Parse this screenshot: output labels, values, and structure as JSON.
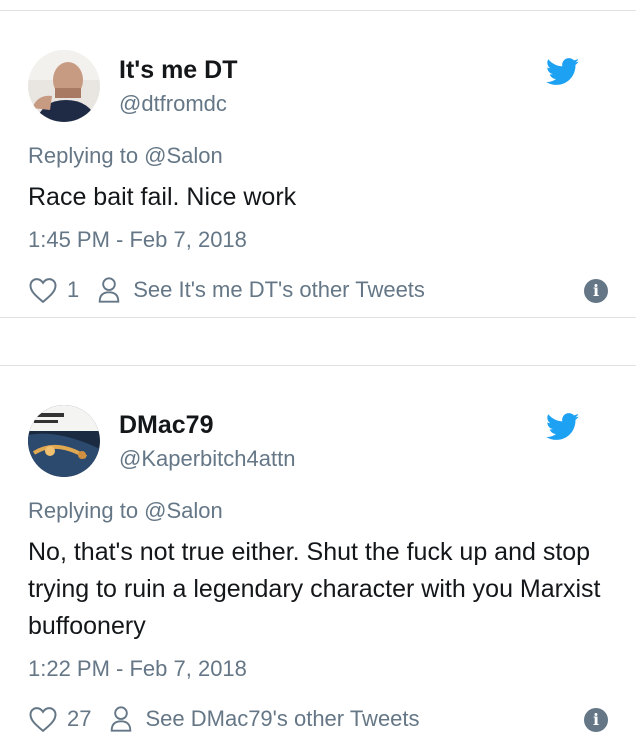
{
  "tweets": [
    {
      "name": "It's me DT",
      "handle": "@dtfromdc",
      "replying": "Replying to @Salon",
      "text": "Race bait fail.  Nice work",
      "time": "1:45 PM - Feb 7, 2018",
      "likes": "1",
      "other_tweets": "See It's me DT's other Tweets"
    },
    {
      "name": "DMac79",
      "handle": "@Kaperbitch4attn",
      "replying": "Replying to @Salon",
      "text": "No, that's not true either.  Shut the fuck up and stop trying to ruin a legendary character with you Marxist buffoonery",
      "time": "1:22 PM - Feb 7, 2018",
      "likes": "27",
      "other_tweets": "See DMac79's other Tweets"
    }
  ],
  "icons": {
    "brand": "twitter-bird-icon",
    "like": "heart-icon",
    "profile": "person-icon",
    "info": "info-icon"
  },
  "colors": {
    "brand_blue": "#1da1f2",
    "secondary_text": "#657786",
    "primary_text": "#14171a",
    "divider": "#dfe3e6"
  }
}
